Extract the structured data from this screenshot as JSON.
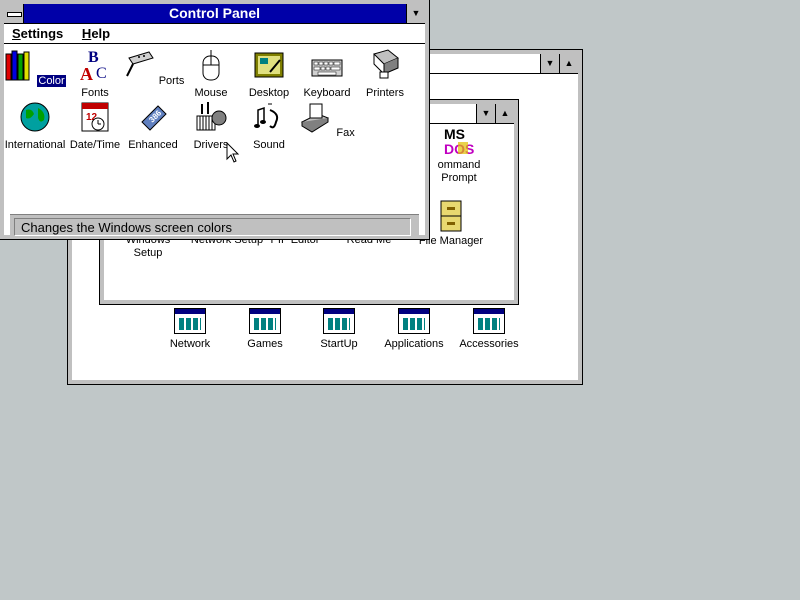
{
  "program_manager": {
    "groups": [
      {
        "label": "Network"
      },
      {
        "label": "Games"
      },
      {
        "label": "StartUp"
      },
      {
        "label": "Applications"
      },
      {
        "label": "Accessories"
      }
    ],
    "partial_items": {
      "command_prompt": "ommand\nPrompt",
      "file_manager": "File Manager",
      "windows_setup": "Windows\nSetup",
      "network_setup": "Network Setup",
      "pif_editor": "PIF Editor",
      "read_me": "Read Me"
    }
  },
  "control_panel": {
    "title": "Control Panel",
    "menu": {
      "settings": "Settings",
      "help": "Help"
    },
    "icons": [
      {
        "label": "Color",
        "selected": true
      },
      {
        "label": "Fonts"
      },
      {
        "label": "Ports"
      },
      {
        "label": "Mouse"
      },
      {
        "label": "Desktop"
      },
      {
        "label": "Keyboard"
      },
      {
        "label": "Printers"
      },
      {
        "label": "International"
      },
      {
        "label": "Date/Time"
      },
      {
        "label": "Enhanced"
      },
      {
        "label": "Drivers"
      },
      {
        "label": "Sound"
      },
      {
        "label": "Fax"
      }
    ],
    "status": "Changes the Windows screen colors"
  },
  "colors": {
    "title_active": "#0000a8",
    "desktop": "#c0c7c8",
    "selection": "#000080"
  }
}
